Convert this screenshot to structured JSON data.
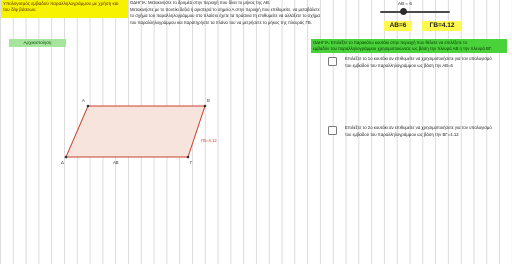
{
  "title_text": "Υπολογισμός εμβαδού παραλληλογράμμου με χρήση και του δ/φ βάσεων.",
  "instructions": [
    "ΟΔΗΓΙΑ: Μετακινήστε το δρομέα στην περιοχή που δίνει το μήκος της ΑΒ.",
    "Μετακινήστε με το ποντίκι δεξιά ή αριστερά το σημείο Α στην περιοχή που επιθυμείτε, να μεταβάλετε",
    "το σχήμα του παραλληλογράμμου   στο πλαίσιο έχετε τα πράσινα τη   επιθυμείτε να αλλάξετε το σχήμα",
    "του παραλληλογράμμου και παρατηρήστε τα πλάνα του να μετρήσετε το μήκος της πλευράς ΓΒ."
  ],
  "reset_button": "Αρχικοποίηση",
  "slider": {
    "label": "AB = 6",
    "value_fraction": 0.33
  },
  "values": {
    "ab": "AB=6",
    "gb": "ΓΒ=4.12"
  },
  "green_bar_text": [
    "ΟΔΗΓΙΑ: Επιλέξτε το παρακάτω κουτάκι στην περιοχή που θέλετε να επιλέξετε το",
    "εμβαδόν του παραλληλογράμμου χρησιμοποιώντας ως βάση την πλευρά ΑΒ ή την πλευρά ΒΓ."
  ],
  "checkboxes": [
    {
      "text": "Επιλέξτε το 1ο κουτάκι αν επιθυμείτε να χρησιμοποιήσετε για τον υπολογισμό του εμβαδού του παραλληλογράμμου ως βάση την ΑΒ=6"
    },
    {
      "text": "Επιλέξτε το 2ο κουτάκι αν επιθυμείτε να χρησιμοποιήσετε για τον υπολογισμό του εμβαδού του παραλληλογράμμου ως βάση την ΒΓ=4.12"
    }
  ],
  "points": {
    "a": "A",
    "b": "B",
    "c": "Γ",
    "d": "Δ"
  },
  "side_label": "ΓΒ=4.12",
  "base_label": "AB",
  "colors": {
    "fill": "#f7e4dd",
    "stroke": "#c9412c",
    "yellow": "#f7f200",
    "green": "#49d23a"
  }
}
